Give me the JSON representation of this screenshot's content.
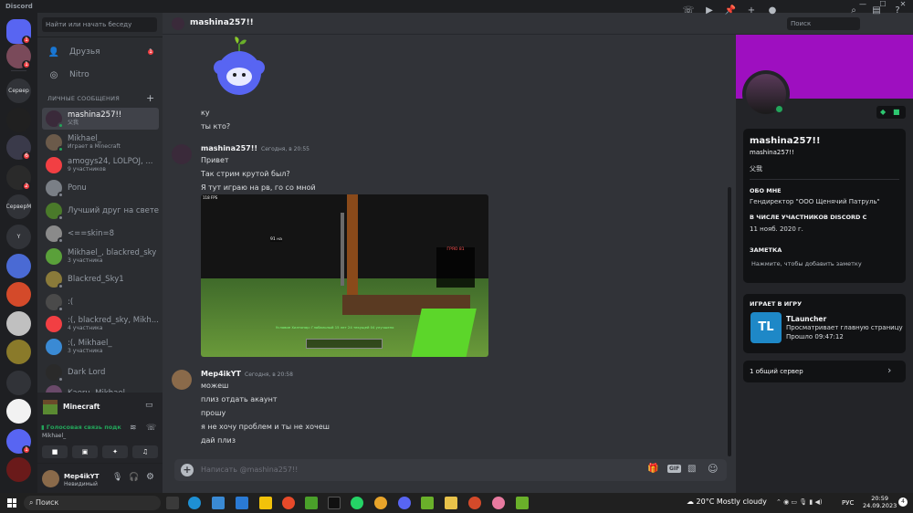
{
  "app": {
    "title": "Discord"
  },
  "colors": {
    "brand": "#5865f2",
    "online": "#23a55a",
    "red": "#f23f43",
    "banner": "#9e0fc0",
    "tl": "#1e88c7"
  },
  "servers": [
    {
      "label": "",
      "badge": "1"
    },
    {
      "label": "",
      "badge": "1"
    },
    {
      "label": "Сервер",
      "badge": ""
    },
    {
      "label": "",
      "badge": ""
    },
    {
      "label": "",
      "badge": "6"
    },
    {
      "label": "",
      "badge": "2"
    },
    {
      "label": "СерверМ",
      "badge": ""
    },
    {
      "label": "Y",
      "badge": ""
    },
    {
      "label": "",
      "badge": ""
    },
    {
      "label": "",
      "badge": ""
    },
    {
      "label": "",
      "badge": ""
    },
    {
      "label": "",
      "badge": ""
    },
    {
      "label": "",
      "badge": ""
    },
    {
      "label": "",
      "badge": ""
    },
    {
      "label": "",
      "badge": "1"
    },
    {
      "label": "",
      "badge": ""
    }
  ],
  "dm_sidebar": {
    "search_placeholder": "Найти или начать беседу",
    "friends_label": "Друзья",
    "friends_badge": "1",
    "nitro_label": "Nitro",
    "dm_header": "ЛИЧНЫЕ СООБЩЕНИЯ",
    "items": [
      {
        "name": "mashina257!!",
        "sub": "父我",
        "color": "#3a2a3a"
      },
      {
        "name": "Mikhael_",
        "sub": "Играет в Minecraft",
        "color": "#6b5a4a"
      },
      {
        "name": "amogys24, LOLPOJ, ...",
        "sub": "9 участников",
        "color": "#f23f43"
      },
      {
        "name": "Ponu",
        "sub": "",
        "color": "#7a7f86"
      },
      {
        "name": "Лучший друг на свете",
        "sub": "",
        "color": "#4a7a2a"
      },
      {
        "name": "<==skin=8",
        "sub": "",
        "color": "#8a8a8a"
      },
      {
        "name": "Mikhael_, blackred_sky",
        "sub": "3 участника",
        "color": "#5aa03a"
      },
      {
        "name": "Blackred_Sky1",
        "sub": "",
        "color": "#8a7a3a"
      },
      {
        "name": ":(",
        "sub": "",
        "color": "#4a4a4a"
      },
      {
        "name": ":(, blackred_sky, Mikh...",
        "sub": "4 участника",
        "color": "#f23f43"
      },
      {
        "name": ":(, Mikhael_",
        "sub": "3 участника",
        "color": "#3a8ad4"
      },
      {
        "name": "Dark Lord",
        "sub": "",
        "color": "#2a2a2a"
      },
      {
        "name": "Kaeru, Mikhael",
        "sub": "",
        "color": "#6a4a6a"
      }
    ]
  },
  "activity": {
    "game": "Minecraft",
    "voice_status": "Голосовая связь подк",
    "voice_user": "Mikhael_"
  },
  "user": {
    "name": "Mep4ikYT",
    "status": "Невидимый"
  },
  "header": {
    "channel": "mashina257!!",
    "search_placeholder": "Поиск"
  },
  "chat": {
    "messages_top": [
      "ку",
      "ты кто?"
    ],
    "group1": {
      "author": "mashina257!!",
      "time": "Сегодня, в 20:55",
      "lines": [
        "Привет",
        "Так стрим крутой был?",
        "Я тут играю на рв, го со мной"
      ]
    },
    "image_overlay": {
      "fps": "118 FPS",
      "tag": "91 на",
      "board_title": "ГРЯО 81",
      "status_line": "Условие Хилтонар: Глобальный 15 лет 24 текущей 04 улучшено"
    },
    "group2": {
      "author": "Mep4ikYT",
      "time": "Сегодня, в 20:58",
      "lines": [
        "можеш",
        "плиз отдать акаунт",
        "прошу",
        "я не хочу проблем и ты не хочеш",
        "дай плиз"
      ]
    },
    "input_placeholder": "Написать @mashina257!!"
  },
  "profile": {
    "display_name": "mashina257!!",
    "username": "mashina257!!",
    "pronouns": "父我",
    "about_label": "ОБО МНЕ",
    "about_text": "Гендиректор \"ООО Щенячий Патруль\"",
    "member_label": "В ЧИСЛЕ УЧАСТНИКОВ DISCORD С",
    "member_since": "11 нояб. 2020 г.",
    "note_label": "ЗАМЕТКА",
    "note_placeholder": "Нажмите, чтобы добавить заметку",
    "playing_label": "ИГРАЕТ В ИГРУ",
    "game_icon": "TL",
    "game_name": "TLauncher",
    "game_detail": "Просматривает главную страницу",
    "game_elapsed": "Прошло 09:47:12",
    "mutual": "1 общий сервер"
  },
  "taskbar": {
    "search": "Поиск",
    "weather": "20°C",
    "weather_text": "Mostly cloudy",
    "lang": "РУС",
    "time": "20:59",
    "date": "24.09.2023"
  }
}
